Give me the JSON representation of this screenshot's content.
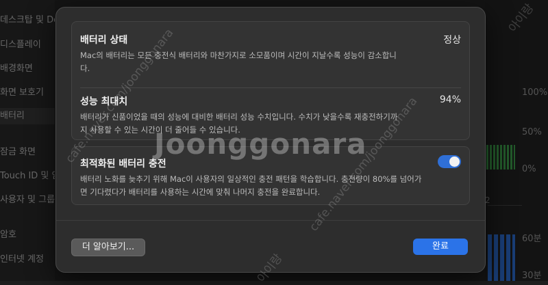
{
  "background": {
    "sidebar_items": [
      {
        "label": "데스크탑 및 Dock",
        "selected": false
      },
      {
        "label": "디스플레이",
        "selected": false
      },
      {
        "label": "배경화면",
        "selected": false
      },
      {
        "label": "화면 보호기",
        "selected": false
      },
      {
        "label": "배터리",
        "selected": true
      },
      {
        "label": "잠금 화면",
        "selected": false
      },
      {
        "label": "Touch ID 및 암호",
        "selected": false
      },
      {
        "label": "사용자 및 그룹",
        "selected": false
      },
      {
        "label": "암호",
        "selected": false
      },
      {
        "label": "인터넷 계정",
        "selected": false
      }
    ],
    "axis_labels": [
      "100%",
      "50%",
      "0%",
      "60분",
      "30분"
    ],
    "tick_label": "2"
  },
  "dialog": {
    "battery_status": {
      "title": "배터리 상태",
      "value": "정상",
      "description": "Mac의 배터리는 모든 충전식 배터리와 마찬가지로 소모품이며 시간이 지날수록 성능이 감소합니다."
    },
    "max_capacity": {
      "title": "성능 최대치",
      "value": "94%",
      "description": "배터리가 신품이었을 때의 성능에 대비한 배터리 성능 수치입니다. 수치가 낮을수록 재충전하기까지 사용할 수 있는 시간이 더 줄어들 수 있습니다."
    },
    "optimized_charging": {
      "title": "최적화된 배터리 충전",
      "enabled": true,
      "description": "배터리 노화를 늦추기 위해 Mac이 사용자의 일상적인 충전 패턴을 학습합니다. 충전량이 80%를 넘어가면 기다렸다가 배터리를 사용하는 시간에 맞춰 나머지 충전을 완료합니다."
    },
    "learn_more_label": "더 알아보기...",
    "done_label": "완료"
  },
  "watermark": {
    "main": "Joonggonara",
    "marks": [
      "cafe.naver.com/joonggonara",
      "아이랑"
    ]
  },
  "colors": {
    "accent": "#2b73e8",
    "toggle_on": "#2f6fd6",
    "battery_green": "#3fa34d"
  }
}
